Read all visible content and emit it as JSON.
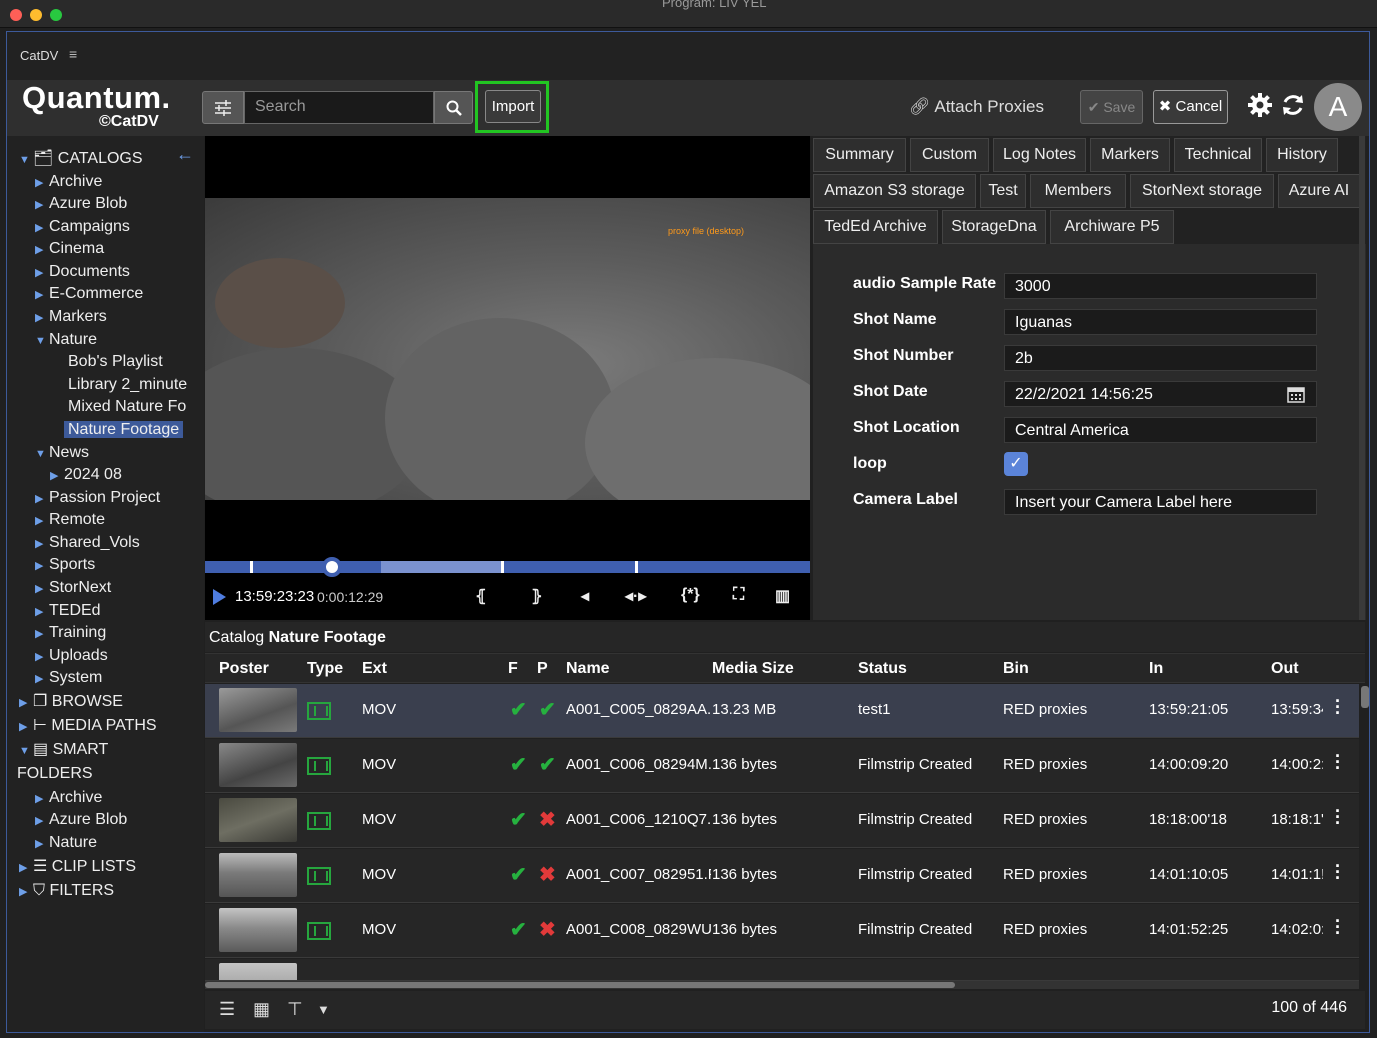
{
  "window": {
    "program_label": "Program: LIV YEL"
  },
  "app": {
    "name": "CatDV"
  },
  "logo": {
    "brand": "Quantum.",
    "product": "CatDV"
  },
  "toolbar": {
    "search_placeholder": "Search",
    "import_label": "Import",
    "attach_label": "Attach Proxies",
    "save_label": "Save",
    "cancel_label": "Cancel",
    "avatar_letter": "A"
  },
  "sidebar": {
    "items": [
      {
        "label": "CATALOGS"
      },
      {
        "label": "Archive"
      },
      {
        "label": "Azure Blob"
      },
      {
        "label": "Campaigns"
      },
      {
        "label": "Cinema"
      },
      {
        "label": "Documents"
      },
      {
        "label": "E-Commerce"
      },
      {
        "label": "Markers"
      },
      {
        "label": "Nature"
      },
      {
        "label": "Bob's Playlist"
      },
      {
        "label": "Library 2_minute"
      },
      {
        "label": "Mixed Nature Fo"
      },
      {
        "label": "Nature Footage"
      },
      {
        "label": "News"
      },
      {
        "label": "2024 08"
      },
      {
        "label": "Passion Project"
      },
      {
        "label": "Remote"
      },
      {
        "label": "Shared_Vols"
      },
      {
        "label": "Sports"
      },
      {
        "label": "StorNext"
      },
      {
        "label": "TEDEd"
      },
      {
        "label": "Training"
      },
      {
        "label": "Uploads"
      },
      {
        "label": "System"
      },
      {
        "label": "BROWSE"
      },
      {
        "label": "MEDIA PATHS"
      },
      {
        "label": "SMART"
      },
      {
        "label": "FOLDERS"
      },
      {
        "label": "Archive"
      },
      {
        "label": "Azure Blob"
      },
      {
        "label": "Nature"
      },
      {
        "label": "CLIP LISTS"
      },
      {
        "label": "FILTERS"
      }
    ]
  },
  "player": {
    "proxy_label": "proxy file (desktop)",
    "timecode": "13:59:23:23",
    "duration": "0:00:12:29"
  },
  "tabs": [
    "Summary",
    "Custom",
    "Log Notes",
    "Markers",
    "Technical",
    "History",
    "Amazon S3 storage",
    "Test",
    "Members",
    "StorNext storage",
    "Azure AI",
    "TedEd Archive",
    "StorageDna",
    "Archiware P5"
  ],
  "fields": [
    {
      "label": "audio Sample Rate",
      "value": "3000"
    },
    {
      "label": "Shot Name",
      "value": "Iguanas"
    },
    {
      "label": "Shot Number",
      "value": "2b"
    },
    {
      "label": "Shot Date",
      "value": "22/2/2021 14:56:25"
    },
    {
      "label": "Shot Location",
      "value": "Central America"
    },
    {
      "label": "loop",
      "value": ""
    },
    {
      "label": "Camera Label",
      "value": "Insert your Camera Label here"
    }
  ],
  "catalog": {
    "prefix": "Catalog",
    "name": "Nature Footage"
  },
  "table": {
    "headers": [
      "Poster",
      "Type",
      "Ext",
      "F",
      "P",
      "Name",
      "Media Size",
      "Status",
      "Bin",
      "In",
      "Out"
    ],
    "rows": [
      {
        "ext": "MOV",
        "f": "ok",
        "p": "ok",
        "name": "A001_C005_0829AA.I",
        "size": "13.23 MB",
        "status": "test1",
        "bin": "RED proxies",
        "in": "13:59:21:05",
        "out": "13:59:34"
      },
      {
        "ext": "MOV",
        "f": "ok",
        "p": "ok",
        "name": "A001_C006_08294M.",
        "size": "136 bytes",
        "status": "Filmstrip Created",
        "bin": "RED proxies",
        "in": "14:00:09:20",
        "out": "14:00:2:"
      },
      {
        "ext": "MOV",
        "f": "ok",
        "p": "x",
        "name": "A001_C006_1210Q7.I",
        "size": "136 bytes",
        "status": "Filmstrip Created",
        "bin": "RED proxies",
        "in": "18:18:00'18",
        "out": "18:18:1'"
      },
      {
        "ext": "MOV",
        "f": "ok",
        "p": "x",
        "name": "A001_C007_082951.F",
        "size": "136 bytes",
        "status": "Filmstrip Created",
        "bin": "RED proxies",
        "in": "14:01:10:05",
        "out": "14:01:1!"
      },
      {
        "ext": "MOV",
        "f": "ok",
        "p": "x",
        "name": "A001_C008_0829WU.",
        "size": "136 bytes",
        "status": "Filmstrip Created",
        "bin": "RED proxies",
        "in": "14:01:52:25",
        "out": "14:02:0:"
      }
    ]
  },
  "footer": {
    "count": "100 of 446"
  }
}
